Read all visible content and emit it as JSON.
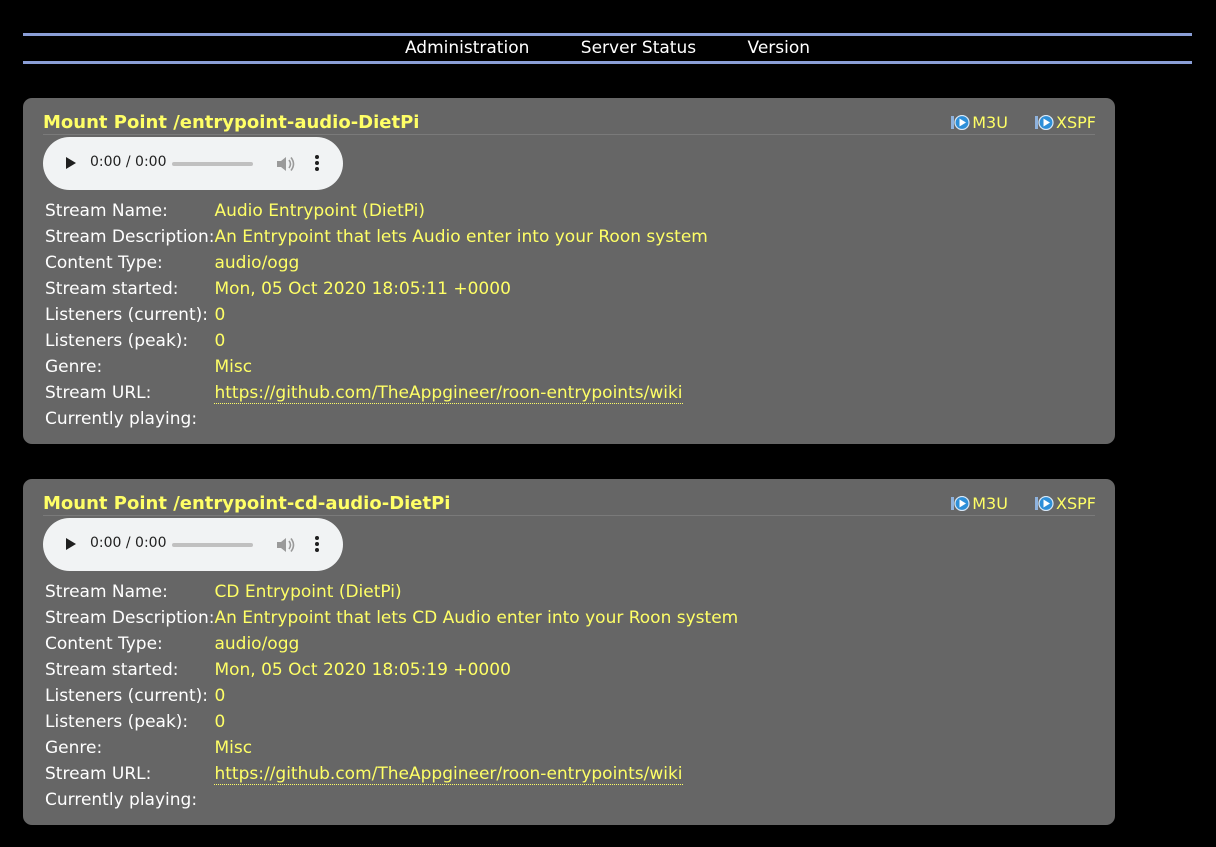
{
  "nav": {
    "items": [
      "Administration",
      "Server Status",
      "Version"
    ]
  },
  "colors": {
    "background": "#000000",
    "panel": "#666666",
    "accent": "#ffff66",
    "nav_rule": "#8a9ed6"
  },
  "playlist": {
    "m3u_label": "M3U",
    "xspf_label": "XSPF",
    "icon": "playlist-play-icon"
  },
  "labels": {
    "stream_name": "Stream Name:",
    "stream_description": "Stream Description:",
    "content_type": "Content Type:",
    "stream_started": "Stream started:",
    "listeners_current": "Listeners (current):",
    "listeners_peak": "Listeners (peak):",
    "genre": "Genre:",
    "stream_url": "Stream URL:",
    "currently_playing": "Currently playing:"
  },
  "mounts": [
    {
      "title": "Mount Point /entrypoint-audio-DietPi",
      "player": {
        "time": "0:00 / 0:00"
      },
      "stream_name": "Audio Entrypoint (DietPi)",
      "stream_description": "An Entrypoint that lets Audio enter into your Roon system",
      "content_type": "audio/ogg",
      "stream_started": "Mon, 05 Oct 2020 18:05:11 +0000",
      "listeners_current": "0",
      "listeners_peak": "0",
      "genre": "Misc",
      "stream_url": "https://github.com/TheAppgineer/roon-entrypoints/wiki",
      "currently_playing": ""
    },
    {
      "title": "Mount Point /entrypoint-cd-audio-DietPi",
      "player": {
        "time": "0:00 / 0:00"
      },
      "stream_name": "CD Entrypoint (DietPi)",
      "stream_description": "An Entrypoint that lets CD Audio enter into your Roon system",
      "content_type": "audio/ogg",
      "stream_started": "Mon, 05 Oct 2020 18:05:19 +0000",
      "listeners_current": "0",
      "listeners_peak": "0",
      "genre": "Misc",
      "stream_url": "https://github.com/TheAppgineer/roon-entrypoints/wiki",
      "currently_playing": ""
    }
  ]
}
